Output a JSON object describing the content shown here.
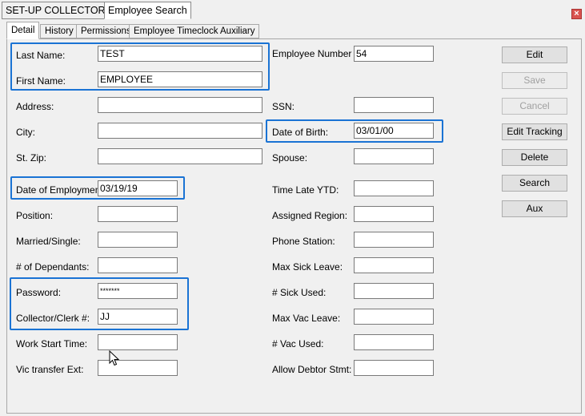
{
  "top_tabs": [
    "SET-UP COLLECTORS",
    "Employee Search"
  ],
  "close_symbol": "×",
  "detail_tabs": [
    "Detail",
    "History",
    "Permissions",
    "Employee Timeclock Auxiliary"
  ],
  "left_fields": [
    {
      "label": "Last Name:",
      "value": "TEST"
    },
    {
      "label": "First Name:",
      "value": "EMPLOYEE"
    },
    {
      "label": "Address:",
      "value": ""
    },
    {
      "label": "City:",
      "value": ""
    },
    {
      "label": "St. Zip:",
      "value": ""
    },
    {
      "label": "Date of Employment:",
      "value": "03/19/19"
    },
    {
      "label": "Position:",
      "value": ""
    },
    {
      "label": "Married/Single:",
      "value": ""
    },
    {
      "label": "# of Dependants:",
      "value": ""
    },
    {
      "label": "Password:",
      "value": "*******"
    },
    {
      "label": "Collector/Clerk #:",
      "value": "JJ"
    },
    {
      "label": "Work Start Time:",
      "value": ""
    },
    {
      "label": "Vic transfer Ext:",
      "value": ""
    }
  ],
  "right_fields": [
    {
      "label": "Employee Number",
      "value": "54"
    },
    {
      "label": "SSN:",
      "value": ""
    },
    {
      "label": "Date of Birth:",
      "value": "03/01/00"
    },
    {
      "label": "Spouse:",
      "value": ""
    },
    {
      "label": "Time Late YTD:",
      "value": ""
    },
    {
      "label": "Assigned Region:",
      "value": ""
    },
    {
      "label": "Phone Station:",
      "value": ""
    },
    {
      "label": "Max Sick Leave:",
      "value": ""
    },
    {
      "label": "# Sick Used:",
      "value": ""
    },
    {
      "label": "Max Vac Leave:",
      "value": ""
    },
    {
      "label": "# Vac Used:",
      "value": ""
    },
    {
      "label": "Allow Debtor Stmt:",
      "value": ""
    }
  ],
  "buttons": [
    {
      "label": "Edit",
      "enabled": true
    },
    {
      "label": "Save",
      "enabled": false
    },
    {
      "label": "Cancel",
      "enabled": false
    },
    {
      "label": "Edit Tracking",
      "enabled": true
    },
    {
      "label": "Delete",
      "enabled": true
    },
    {
      "label": "Search",
      "enabled": true
    },
    {
      "label": "Aux",
      "enabled": true
    }
  ],
  "colors": {
    "highlight": "#1a73d4",
    "close_button": "#d9534f"
  }
}
